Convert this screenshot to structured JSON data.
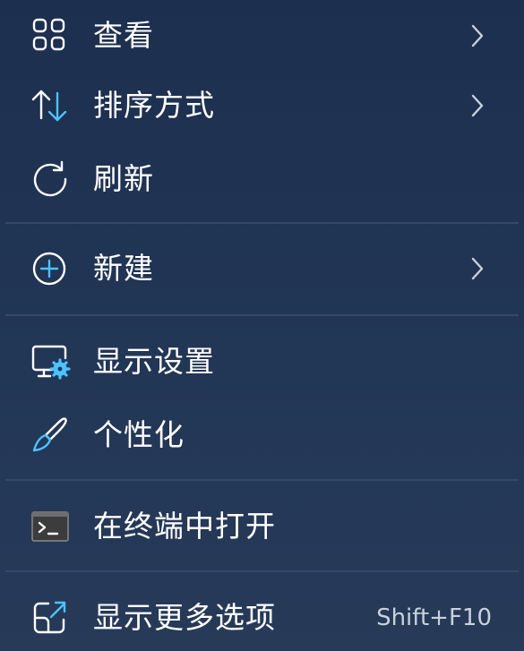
{
  "context_menu": {
    "items": [
      {
        "label": "查看",
        "icon": "grid-view-icon",
        "has_submenu": true
      },
      {
        "label": "排序方式",
        "icon": "sort-arrows-icon",
        "has_submenu": true
      },
      {
        "label": "刷新",
        "icon": "refresh-icon",
        "has_submenu": false
      },
      {
        "label": "新建",
        "icon": "add-circle-icon",
        "has_submenu": true
      },
      {
        "label": "显示设置",
        "icon": "display-settings-icon",
        "has_submenu": false
      },
      {
        "label": "个性化",
        "icon": "paintbrush-icon",
        "has_submenu": false
      },
      {
        "label": "在终端中打开",
        "icon": "terminal-icon",
        "has_submenu": false
      },
      {
        "label": "显示更多选项",
        "icon": "open-external-icon",
        "has_submenu": false,
        "shortcut": "Shift+F10"
      }
    ]
  },
  "colors": {
    "background": "#1f3151",
    "accent": "#4cc2ff",
    "text": "#ffffff",
    "separator": "#34486a"
  }
}
